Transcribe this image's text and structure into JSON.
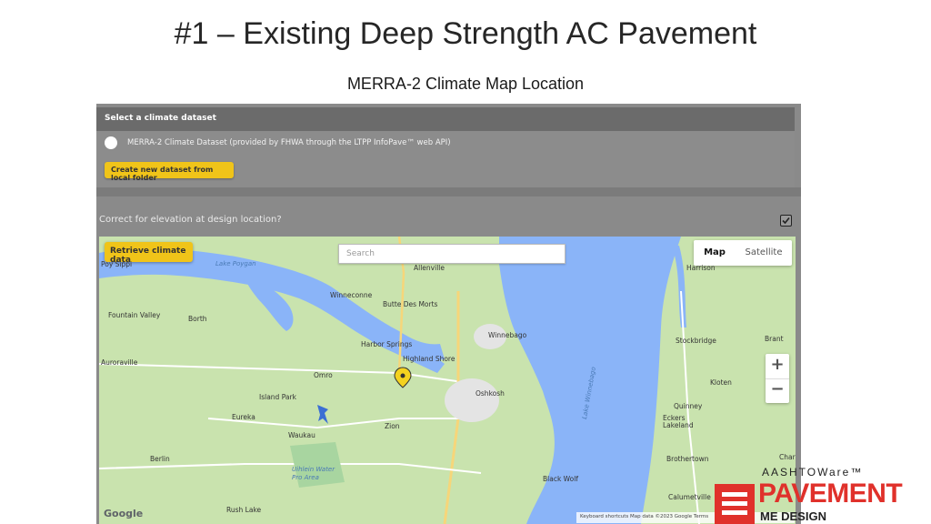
{
  "slide": {
    "title": "#1 – Existing Deep Strength AC Pavement",
    "subtitle": "MERRA-2 Climate Map Location"
  },
  "dataset_panel": {
    "header": "Select a climate dataset",
    "option_label": "MERRA-2 Climate Dataset (provided by FHWA through the LTPP InfoPave™ web API)",
    "create_button": "Create new dataset from local folder"
  },
  "elevation": {
    "label": "Correct for elevation at design location?",
    "checked": true
  },
  "map": {
    "retrieve_button": "Retrieve climate data",
    "search_placeholder": "Search",
    "maptype_map": "Map",
    "maptype_satellite": "Satellite",
    "zoom_in": "+",
    "zoom_out": "−",
    "google": "Google",
    "attribution": "Keyboard shortcuts   Map data ©2023 Google   Terms",
    "labels": {
      "poy_sippi": "Poy Sippi",
      "lake_poygan": "Lake Poygan",
      "allenville": "Allenville",
      "winneconne": "Winneconne",
      "butte_des_morts": "Butte Des Morts",
      "fountain_valley": "Fountain Valley",
      "borth": "Borth",
      "winnebago": "Winnebago",
      "harbor_springs": "Harbor Springs",
      "highland_shore": "Highland Shore",
      "auroraville": "Auroraville",
      "omro": "Omro",
      "oshkosh": "Oshkosh",
      "island_park": "Island Park",
      "eureka": "Eureka",
      "zion": "Zion",
      "waukau": "Waukau",
      "berlin": "Berlin",
      "uihlein": "Uihlein Water Pro Area",
      "rush_lake": "Rush Lake",
      "black_wolf": "Black Wolf",
      "lake_winnebago": "Lake Winnebago",
      "harrison": "Harrison",
      "stockbridge": "Stockbridge",
      "brant": "Brant",
      "kloten": "Kloten",
      "quinney": "Quinney",
      "eckers_lakeland": "Eckers Lakeland",
      "brothertown": "Brothertown",
      "calumetville": "Calumetville",
      "char": "Char"
    }
  },
  "logo": {
    "aashto": "AASHTOWare™",
    "pavement": "PAVEMENT",
    "me_design": "ME DESIGN"
  },
  "colors": {
    "accent_yellow": "#f0c419",
    "brand_red": "#e0312b",
    "water": "#8ab4f8",
    "land": "#c9e3ae"
  }
}
